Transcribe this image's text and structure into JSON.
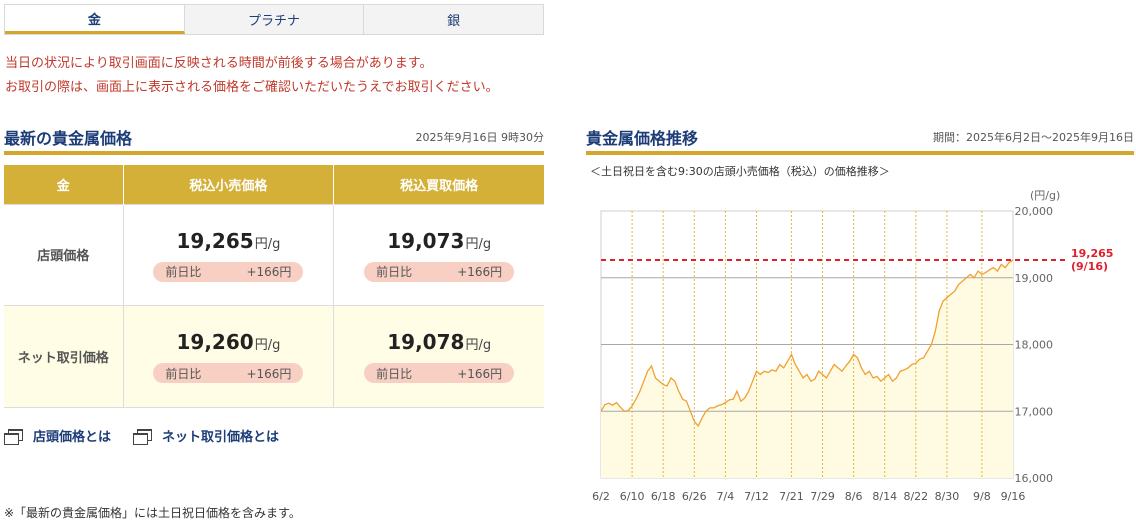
{
  "tabs": [
    {
      "label": "金",
      "active": true
    },
    {
      "label": "プラチナ",
      "active": false
    },
    {
      "label": "銀",
      "active": false
    }
  ],
  "notice": {
    "line1": "当日の状況により取引画面に反映される時間が前後する場合があります。",
    "line2": "お取引の際は、画面上に表示される価格をご確認いただいたうえでお取引ください。"
  },
  "latest": {
    "title": "最新の貴金属価格",
    "datetime": "2025年9月16日 9時30分",
    "headers": [
      "金",
      "税込小売価格",
      "税込買取価格"
    ],
    "rows": [
      {
        "label": "店頭価格",
        "retail": {
          "price": "19,265",
          "unit": "円/g",
          "diff_label": "前日比",
          "diff": "+166円"
        },
        "buy": {
          "price": "19,073",
          "unit": "円/g",
          "diff_label": "前日比",
          "diff": "+166円"
        }
      },
      {
        "label": "ネット取引価格",
        "retail": {
          "price": "19,260",
          "unit": "円/g",
          "diff_label": "前日比",
          "diff": "+166円"
        },
        "buy": {
          "price": "19,078",
          "unit": "円/g",
          "diff_label": "前日比",
          "diff": "+166円"
        }
      }
    ]
  },
  "links": {
    "store": "店頭価格とは",
    "net": "ネット取引価格とは"
  },
  "footnote": "※「最新の貴金属価格」には土日祝日価格を含みます。",
  "trend": {
    "title": "貴金属価格推移",
    "period": "期間：2025年6月2日〜2025年9月16日",
    "caption": "＜土日祝日を含む9:30の店頭小売価格（税込）の価格推移＞"
  },
  "chart_data": {
    "type": "area",
    "unit": "(円/g)",
    "ylim": [
      16000,
      20000
    ],
    "y_ticks": [
      "16,000",
      "17,000",
      "18,000",
      "19,000",
      "20,000"
    ],
    "y_tick_values": [
      16000,
      17000,
      18000,
      19000,
      20000
    ],
    "x_ticks": [
      "6/2",
      "6/10",
      "6/18",
      "6/26",
      "7/4",
      "7/12",
      "7/21",
      "7/29",
      "8/6",
      "8/14",
      "8/22",
      "8/30",
      "9/8",
      "9/16"
    ],
    "x_tick_index": [
      0,
      8,
      16,
      24,
      32,
      40,
      49,
      57,
      65,
      73,
      81,
      89,
      98,
      106
    ],
    "current": {
      "value": 19265,
      "label": "19,265",
      "date_label": "(9/16)"
    },
    "series": [
      {
        "values": [
          17000,
          17100,
          17120,
          17090,
          17130,
          17060,
          17000,
          17010,
          17080,
          17180,
          17300,
          17450,
          17600,
          17680,
          17500,
          17450,
          17400,
          17380,
          17500,
          17450,
          17300,
          17180,
          17150,
          17000,
          16850,
          16780,
          16900,
          17000,
          17050,
          17050,
          17080,
          17100,
          17130,
          17170,
          17180,
          17300,
          17150,
          17200,
          17300,
          17450,
          17600,
          17550,
          17600,
          17580,
          17620,
          17600,
          17700,
          17650,
          17750,
          17850,
          17700,
          17600,
          17500,
          17550,
          17450,
          17480,
          17600,
          17550,
          17500,
          17600,
          17700,
          17650,
          17600,
          17680,
          17750,
          17850,
          17800,
          17650,
          17550,
          17600,
          17500,
          17520,
          17450,
          17500,
          17550,
          17450,
          17500,
          17600,
          17620,
          17650,
          17700,
          17720,
          17780,
          17800,
          17900,
          18000,
          18200,
          18500,
          18650,
          18700,
          18750,
          18800,
          18900,
          18950,
          19000,
          19050,
          19000,
          19100,
          19050,
          19080,
          19120,
          19150,
          19100,
          19200,
          19150,
          19230,
          19265
        ]
      }
    ]
  },
  "colors": {
    "brand": "#1d3d78",
    "gold": "#d4a72c",
    "alert": "#c0392b",
    "line": "#f0a030",
    "area": "#fffbe3",
    "ref_line": "#e0202a"
  }
}
